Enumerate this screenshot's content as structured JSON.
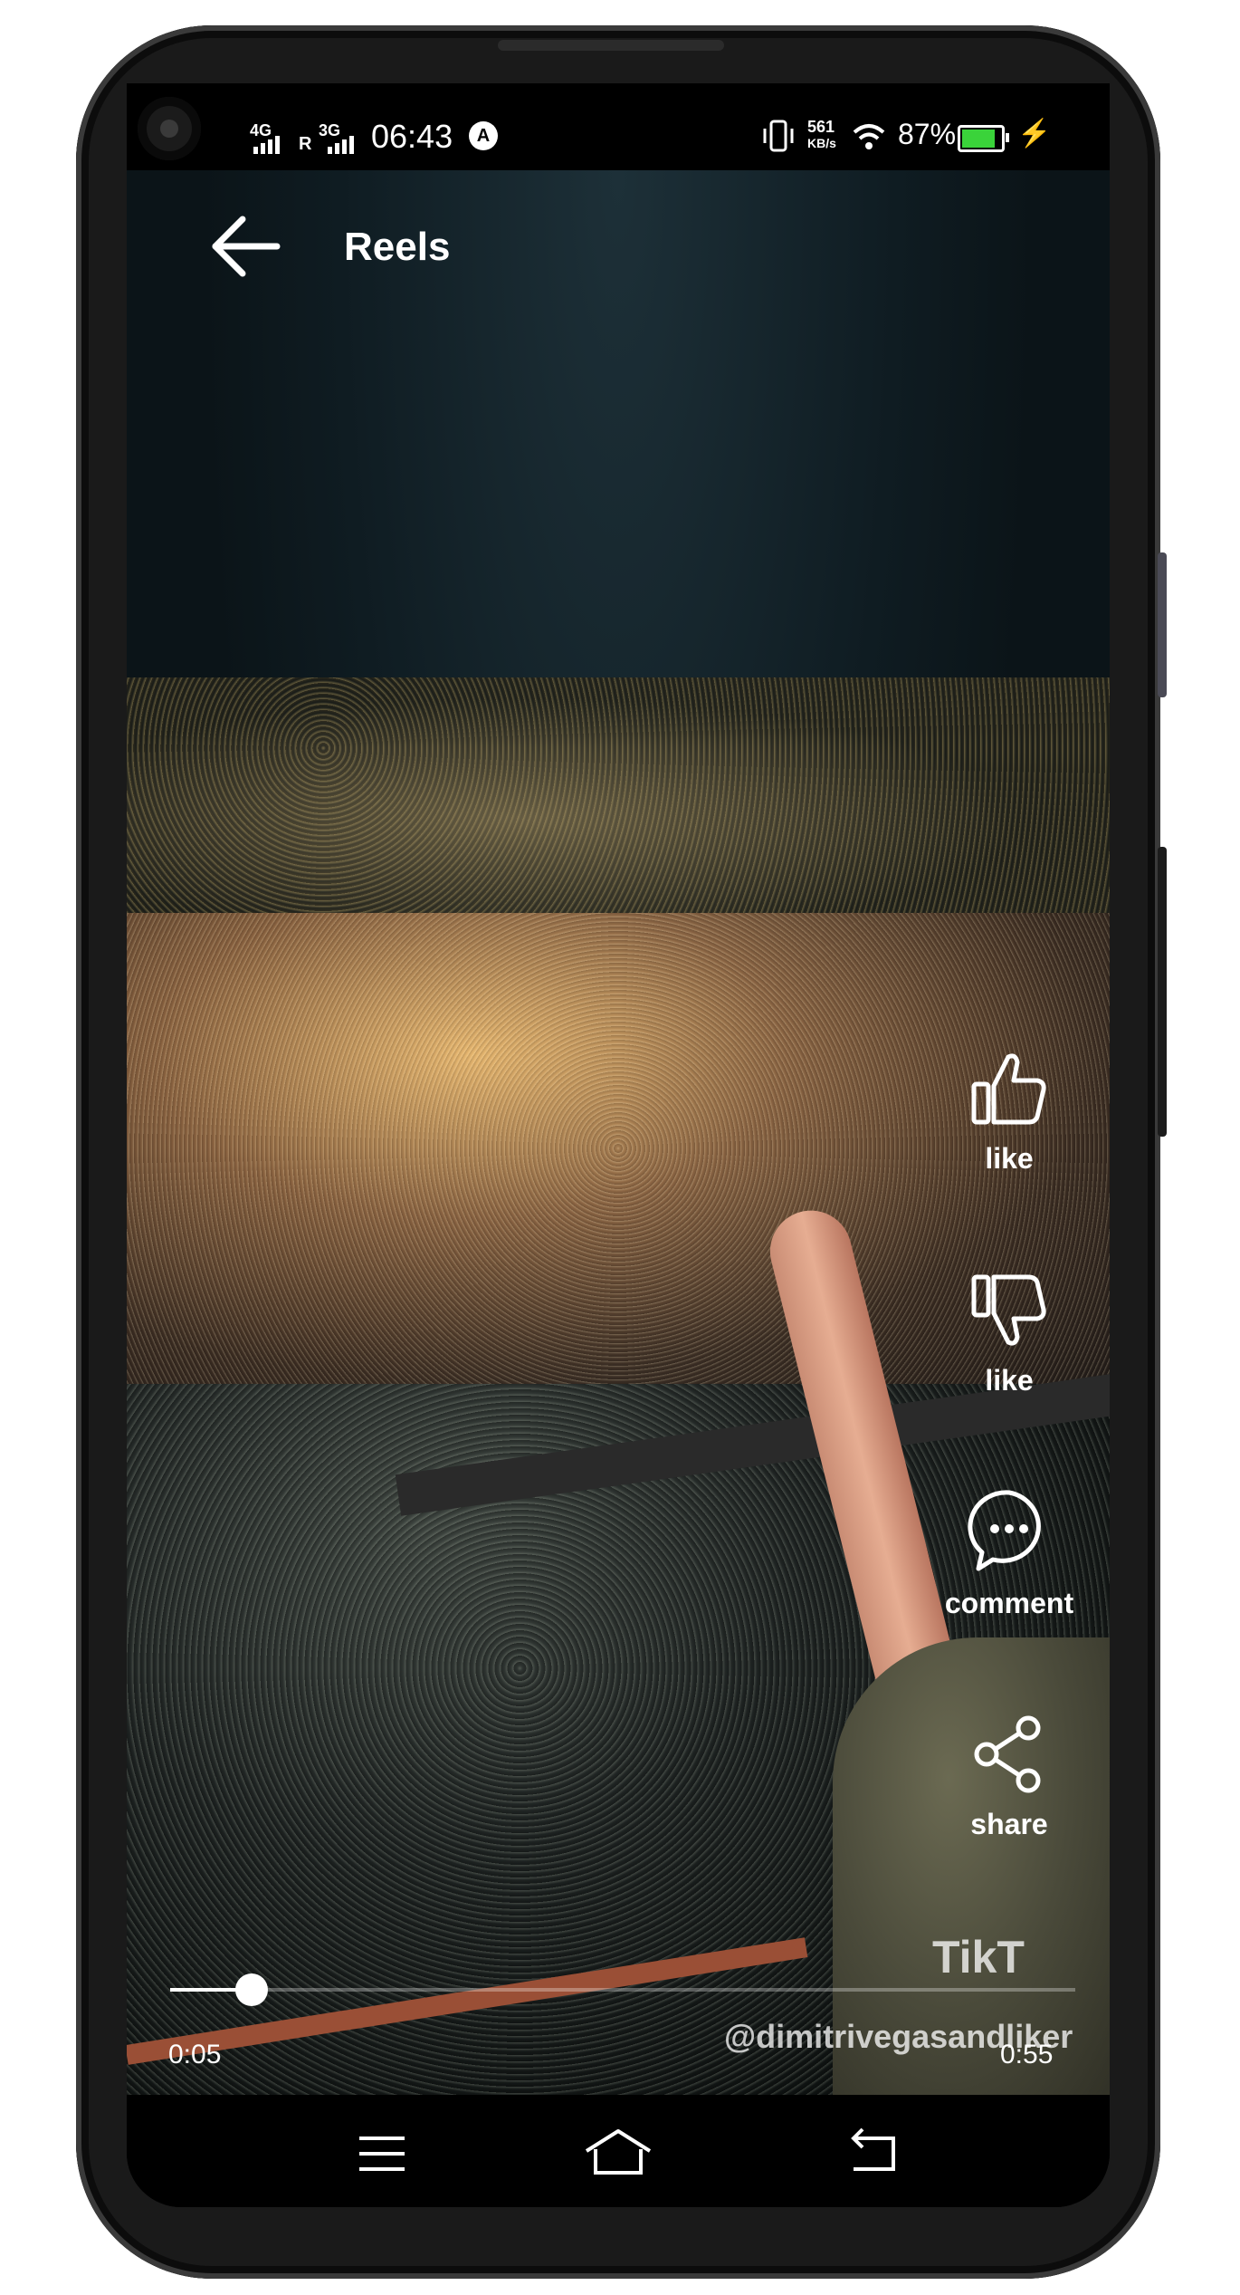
{
  "status_bar": {
    "signal_1": "4G",
    "roaming": "R",
    "signal_2": "3G",
    "time": "06:43",
    "app_indicator": "A",
    "data_speed_value": "561",
    "data_speed_unit": "KB/s",
    "battery_percent": "87%",
    "icons": [
      "vibrate-icon",
      "wifi-icon",
      "battery-icon",
      "charging-bolt-icon"
    ]
  },
  "header": {
    "back_icon": "arrow-left-icon",
    "title": "Reels"
  },
  "actions": [
    {
      "icon": "thumbs-up-icon",
      "label": "like"
    },
    {
      "icon": "thumbs-down-icon",
      "label": "like"
    },
    {
      "icon": "comment-bubble-icon",
      "label": "comment"
    },
    {
      "icon": "share-icon",
      "label": "share"
    }
  ],
  "video": {
    "watermark_logo": "TikT",
    "watermark_user": "@dimitrivegasandliker",
    "current_time": "0:05",
    "duration": "0:55",
    "progress_fraction": 0.09
  },
  "nav_bar": {
    "icons": [
      "menu-icon",
      "home-icon",
      "back-icon"
    ]
  },
  "colors": {
    "battery_fill": "#3ad33a",
    "charging_bolt": "#f5c518",
    "text": "#ffffff"
  }
}
